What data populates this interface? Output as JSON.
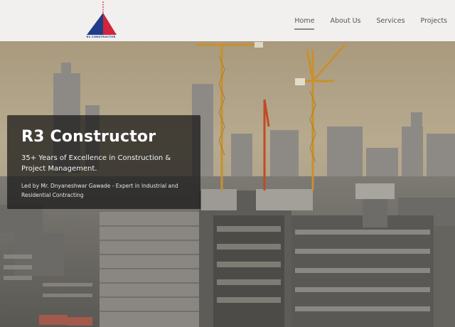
{
  "header": {
    "logo_text": "R3 CONSTRUCTOR",
    "nav": [
      {
        "label": "Home",
        "active": true
      },
      {
        "label": "About Us",
        "active": false
      },
      {
        "label": "Services",
        "active": false
      },
      {
        "label": "Projects",
        "active": false
      }
    ]
  },
  "hero": {
    "title": "R3 Constructor",
    "subtitle": "35+ Years of Excellence in Construction & Project Management.",
    "description": "Led by Mr. Dnyaneshwar Gawade - Expert in Industrial and Residential Contracting"
  },
  "colors": {
    "logo_blue": "#1f3d8a",
    "logo_red": "#d0253a",
    "header_bg": "#f1f0ee"
  },
  "icons": [
    "logo-triangle-icon"
  ]
}
